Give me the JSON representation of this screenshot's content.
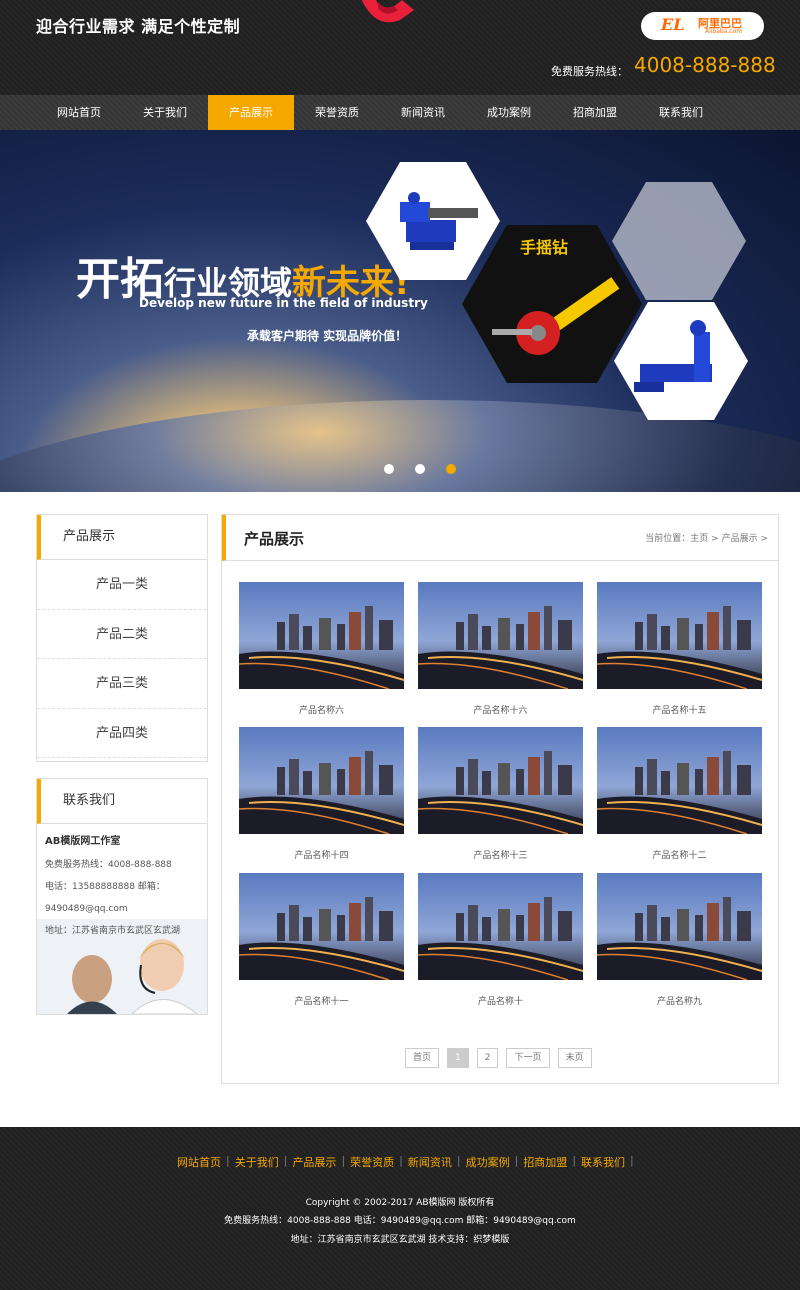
{
  "header": {
    "slogan": "迎合行业需求 满足个性定制",
    "alibaba_badge": {
      "mark": "EL",
      "cn": "阿里巴巴",
      "en": "Alibaba.com"
    },
    "hotline_label": "免费服务热线：",
    "hotline_number": "4008-888-888"
  },
  "nav": {
    "items": [
      "网站首页",
      "关于我们",
      "产品展示",
      "荣誉资质",
      "新闻资讯",
      "成功案例",
      "招商加盟",
      "联系我们"
    ],
    "active_index": 2
  },
  "banner": {
    "title_part1": "开拓",
    "title_part2": "行业领域",
    "title_part3": "新未来!",
    "subtitle_en": "Develop new future in the field of industry",
    "tagline": "承载客户期待 实现品牌价值！",
    "product_label": "手摇钻",
    "slide_count": 3,
    "active_slide": 3
  },
  "sidebar": {
    "categories_title": "产品展示",
    "categories": [
      "产品一类",
      "产品二类",
      "产品三类",
      "产品四类"
    ],
    "contact_title": "联系我们",
    "contact": {
      "company": "AB模版网工作室",
      "hotline": "免费服务热线：4008-888-888",
      "phone_email": "电话：13588888888 邮箱：",
      "email": "9490489@qq.com",
      "address": "地址：江苏省南京市玄武区玄武湖"
    }
  },
  "main": {
    "title": "产品展示",
    "breadcrumb": {
      "prefix": "当前位置：",
      "home": "主页",
      "sep1": " > ",
      "current": "产品展示",
      "sep2": " >"
    },
    "products": [
      "产品名称六",
      "产品名称十六",
      "产品名称十五",
      "产品名称十四",
      "产品名称十三",
      "产品名称十二",
      "产品名称十一",
      "产品名称十",
      "产品名称九"
    ],
    "pager": {
      "first": "首页",
      "pages": [
        "1",
        "2"
      ],
      "current": "1",
      "next": "下一页",
      "last": "末页"
    }
  },
  "footer": {
    "links": [
      "网站首页",
      "关于我们",
      "产品展示",
      "荣誉资质",
      "新闻资讯",
      "成功案例",
      "招商加盟",
      "联系我们"
    ],
    "copyright": "Copyright © 2002-2017 AB模版网 版权所有",
    "contact_line": "免费服务热线：4008-888-888 电话：9490489@qq.com 邮箱：9490489@qq.com",
    "address_line": "地址：江苏省南京市玄武区玄武湖 技术支持：织梦模版"
  },
  "colors": {
    "accent": "#f5a800",
    "dark": "#222222",
    "nav": "#3a3a3a",
    "border": "#dddddd"
  }
}
